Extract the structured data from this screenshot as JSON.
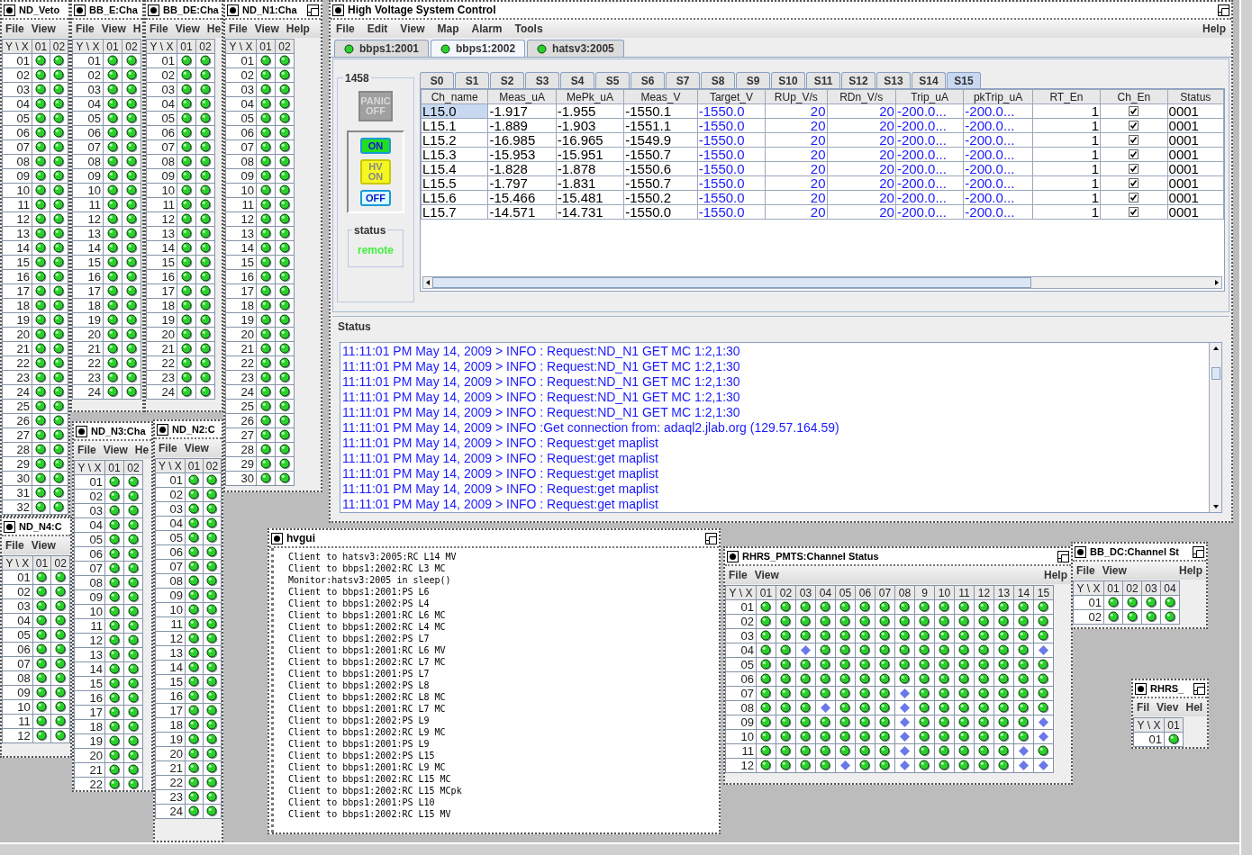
{
  "channel_windows": [
    {
      "title": "ND_Veto",
      "menu": [
        "File",
        "View"
      ],
      "columns": [
        "Y \\ X",
        "01",
        "02"
      ],
      "rows": [
        {
          "label": "01",
          "cells": [
            true,
            true
          ]
        },
        {
          "label": "02",
          "cells": [
            true,
            true
          ]
        },
        {
          "label": "03",
          "cells": [
            true,
            true
          ]
        },
        {
          "label": "04",
          "cells": [
            true,
            true
          ]
        },
        {
          "label": "05",
          "cells": [
            true,
            true
          ]
        },
        {
          "label": "06",
          "cells": [
            true,
            true
          ]
        },
        {
          "label": "07",
          "cells": [
            true,
            true
          ]
        },
        {
          "label": "08",
          "cells": [
            true,
            true
          ]
        },
        {
          "label": "09",
          "cells": [
            true,
            true
          ]
        },
        {
          "label": "10",
          "cells": [
            true,
            true
          ]
        },
        {
          "label": "11",
          "cells": [
            true,
            true
          ]
        },
        {
          "label": "12",
          "cells": [
            true,
            true
          ]
        },
        {
          "label": "13",
          "cells": [
            true,
            true
          ]
        },
        {
          "label": "14",
          "cells": [
            true,
            true
          ]
        },
        {
          "label": "15",
          "cells": [
            true,
            true
          ]
        },
        {
          "label": "16",
          "cells": [
            true,
            true
          ]
        },
        {
          "label": "17",
          "cells": [
            true,
            true
          ]
        },
        {
          "label": "18",
          "cells": [
            true,
            true
          ]
        },
        {
          "label": "19",
          "cells": [
            true,
            true
          ]
        },
        {
          "label": "20",
          "cells": [
            true,
            true
          ]
        },
        {
          "label": "21",
          "cells": [
            true,
            true
          ]
        },
        {
          "label": "22",
          "cells": [
            true,
            true
          ]
        },
        {
          "label": "23",
          "cells": [
            true,
            true
          ]
        },
        {
          "label": "24",
          "cells": [
            true,
            true
          ]
        },
        {
          "label": "25",
          "cells": [
            true,
            true
          ]
        },
        {
          "label": "26",
          "cells": [
            true,
            true
          ]
        },
        {
          "label": "27",
          "cells": [
            true,
            true
          ]
        },
        {
          "label": "28",
          "cells": [
            true,
            true
          ]
        },
        {
          "label": "29",
          "cells": [
            true,
            true
          ]
        },
        {
          "label": "30",
          "cells": [
            true,
            true
          ]
        },
        {
          "label": "31",
          "cells": [
            true,
            true
          ]
        },
        {
          "label": "32",
          "cells": [
            true,
            true
          ]
        }
      ]
    },
    {
      "title": "BB_E:Cha",
      "menu": [
        "File",
        "View",
        "H"
      ],
      "columns": [
        "Y \\ X",
        "01",
        "02"
      ],
      "rows": [
        {
          "label": "01",
          "cells": [
            true,
            true
          ]
        },
        {
          "label": "02",
          "cells": [
            true,
            true
          ]
        },
        {
          "label": "03",
          "cells": [
            true,
            true
          ]
        },
        {
          "label": "04",
          "cells": [
            true,
            true
          ]
        },
        {
          "label": "05",
          "cells": [
            true,
            true
          ]
        },
        {
          "label": "06",
          "cells": [
            true,
            true
          ]
        },
        {
          "label": "07",
          "cells": [
            true,
            true
          ]
        },
        {
          "label": "08",
          "cells": [
            true,
            true
          ]
        },
        {
          "label": "09",
          "cells": [
            true,
            true
          ]
        },
        {
          "label": "10",
          "cells": [
            true,
            true
          ]
        },
        {
          "label": "11",
          "cells": [
            true,
            true
          ]
        },
        {
          "label": "12",
          "cells": [
            true,
            true
          ]
        },
        {
          "label": "13",
          "cells": [
            true,
            true
          ]
        },
        {
          "label": "14",
          "cells": [
            true,
            true
          ]
        },
        {
          "label": "15",
          "cells": [
            true,
            true
          ]
        },
        {
          "label": "16",
          "cells": [
            true,
            true
          ]
        },
        {
          "label": "17",
          "cells": [
            true,
            true
          ]
        },
        {
          "label": "18",
          "cells": [
            true,
            true
          ]
        },
        {
          "label": "19",
          "cells": [
            true,
            true
          ]
        },
        {
          "label": "20",
          "cells": [
            true,
            true
          ]
        },
        {
          "label": "21",
          "cells": [
            true,
            true
          ]
        },
        {
          "label": "22",
          "cells": [
            true,
            true
          ]
        },
        {
          "label": "23",
          "cells": [
            true,
            true
          ]
        },
        {
          "label": "24",
          "cells": [
            true,
            true
          ]
        }
      ]
    },
    {
      "title": "BB_DE:Cha",
      "menu": [
        "File",
        "View",
        "He"
      ],
      "columns": [
        "Y \\ X",
        "01",
        "02"
      ],
      "rows": [
        {
          "label": "01",
          "cells": [
            true,
            true
          ]
        },
        {
          "label": "02",
          "cells": [
            true,
            true
          ]
        },
        {
          "label": "03",
          "cells": [
            true,
            true
          ]
        },
        {
          "label": "04",
          "cells": [
            true,
            true
          ]
        },
        {
          "label": "05",
          "cells": [
            true,
            true
          ]
        },
        {
          "label": "06",
          "cells": [
            true,
            true
          ]
        },
        {
          "label": "07",
          "cells": [
            true,
            true
          ]
        },
        {
          "label": "08",
          "cells": [
            true,
            true
          ]
        },
        {
          "label": "09",
          "cells": [
            true,
            true
          ]
        },
        {
          "label": "10",
          "cells": [
            true,
            true
          ]
        },
        {
          "label": "11",
          "cells": [
            true,
            true
          ]
        },
        {
          "label": "12",
          "cells": [
            true,
            true
          ]
        },
        {
          "label": "13",
          "cells": [
            true,
            true
          ]
        },
        {
          "label": "14",
          "cells": [
            true,
            true
          ]
        },
        {
          "label": "15",
          "cells": [
            true,
            true
          ]
        },
        {
          "label": "16",
          "cells": [
            true,
            true
          ]
        },
        {
          "label": "17",
          "cells": [
            true,
            true
          ]
        },
        {
          "label": "18",
          "cells": [
            true,
            true
          ]
        },
        {
          "label": "19",
          "cells": [
            true,
            true
          ]
        },
        {
          "label": "20",
          "cells": [
            true,
            true
          ]
        },
        {
          "label": "21",
          "cells": [
            true,
            true
          ]
        },
        {
          "label": "22",
          "cells": [
            true,
            true
          ]
        },
        {
          "label": "23",
          "cells": [
            true,
            true
          ]
        },
        {
          "label": "24",
          "cells": [
            true,
            true
          ]
        }
      ]
    },
    {
      "title": "ND_N1:Cha",
      "menu": [
        "File",
        "View",
        "Help"
      ],
      "columns": [
        "Y \\ X",
        "01",
        "02"
      ],
      "rows": [
        {
          "label": "01",
          "cells": [
            true,
            true
          ]
        },
        {
          "label": "02",
          "cells": [
            true,
            true
          ]
        },
        {
          "label": "03",
          "cells": [
            true,
            true
          ]
        },
        {
          "label": "04",
          "cells": [
            true,
            true
          ]
        },
        {
          "label": "05",
          "cells": [
            true,
            true
          ]
        },
        {
          "label": "06",
          "cells": [
            true,
            true
          ]
        },
        {
          "label": "07",
          "cells": [
            true,
            true
          ]
        },
        {
          "label": "08",
          "cells": [
            true,
            true
          ]
        },
        {
          "label": "09",
          "cells": [
            true,
            true
          ]
        },
        {
          "label": "10",
          "cells": [
            true,
            true
          ]
        },
        {
          "label": "11",
          "cells": [
            true,
            true
          ]
        },
        {
          "label": "12",
          "cells": [
            true,
            true
          ]
        },
        {
          "label": "13",
          "cells": [
            true,
            true
          ]
        },
        {
          "label": "14",
          "cells": [
            true,
            true
          ]
        },
        {
          "label": "15",
          "cells": [
            true,
            true
          ]
        },
        {
          "label": "16",
          "cells": [
            true,
            true
          ]
        },
        {
          "label": "17",
          "cells": [
            true,
            true
          ]
        },
        {
          "label": "18",
          "cells": [
            true,
            true
          ]
        },
        {
          "label": "19",
          "cells": [
            true,
            true
          ]
        },
        {
          "label": "20",
          "cells": [
            true,
            true
          ]
        },
        {
          "label": "21",
          "cells": [
            true,
            true
          ]
        },
        {
          "label": "22",
          "cells": [
            true,
            true
          ]
        },
        {
          "label": "23",
          "cells": [
            true,
            true
          ]
        },
        {
          "label": "24",
          "cells": [
            true,
            true
          ]
        },
        {
          "label": "25",
          "cells": [
            true,
            true
          ]
        },
        {
          "label": "26",
          "cells": [
            true,
            true
          ]
        },
        {
          "label": "27",
          "cells": [
            true,
            true
          ]
        },
        {
          "label": "28",
          "cells": [
            true,
            true
          ]
        },
        {
          "label": "29",
          "cells": [
            true,
            true
          ]
        },
        {
          "label": "30",
          "cells": [
            true,
            true
          ]
        }
      ]
    },
    {
      "title": "ND_N3:Cha",
      "menu": [
        "File",
        "View",
        "He"
      ],
      "columns": [
        "Y \\ X",
        "01",
        "02"
      ],
      "rows": [
        {
          "label": "01",
          "cells": [
            true,
            true
          ]
        },
        {
          "label": "02",
          "cells": [
            true,
            true
          ]
        },
        {
          "label": "03",
          "cells": [
            true,
            true
          ]
        },
        {
          "label": "04",
          "cells": [
            true,
            true
          ]
        },
        {
          "label": "05",
          "cells": [
            true,
            true
          ]
        },
        {
          "label": "06",
          "cells": [
            true,
            true
          ]
        },
        {
          "label": "07",
          "cells": [
            true,
            true
          ]
        },
        {
          "label": "08",
          "cells": [
            true,
            true
          ]
        },
        {
          "label": "09",
          "cells": [
            true,
            true
          ]
        },
        {
          "label": "10",
          "cells": [
            true,
            true
          ]
        },
        {
          "label": "11",
          "cells": [
            true,
            true
          ]
        },
        {
          "label": "12",
          "cells": [
            true,
            true
          ]
        },
        {
          "label": "13",
          "cells": [
            true,
            true
          ]
        },
        {
          "label": "14",
          "cells": [
            true,
            true
          ]
        },
        {
          "label": "15",
          "cells": [
            true,
            true
          ]
        },
        {
          "label": "16",
          "cells": [
            true,
            true
          ]
        },
        {
          "label": "17",
          "cells": [
            true,
            true
          ]
        },
        {
          "label": "18",
          "cells": [
            true,
            true
          ]
        },
        {
          "label": "19",
          "cells": [
            true,
            true
          ]
        },
        {
          "label": "20",
          "cells": [
            true,
            true
          ]
        },
        {
          "label": "21",
          "cells": [
            true,
            true
          ]
        },
        {
          "label": "22",
          "cells": [
            true,
            true
          ]
        }
      ]
    },
    {
      "title": "ND_N2:C",
      "menu": [
        "File",
        "View"
      ],
      "columns": [
        "Y \\ X",
        "01",
        "02"
      ],
      "rows": [
        {
          "label": "01",
          "cells": [
            true,
            true
          ]
        },
        {
          "label": "02",
          "cells": [
            true,
            true
          ]
        },
        {
          "label": "03",
          "cells": [
            true,
            true
          ]
        },
        {
          "label": "04",
          "cells": [
            true,
            true
          ]
        },
        {
          "label": "05",
          "cells": [
            true,
            true
          ]
        },
        {
          "label": "06",
          "cells": [
            true,
            true
          ]
        },
        {
          "label": "07",
          "cells": [
            true,
            true
          ]
        },
        {
          "label": "08",
          "cells": [
            true,
            true
          ]
        },
        {
          "label": "09",
          "cells": [
            true,
            true
          ]
        },
        {
          "label": "10",
          "cells": [
            true,
            true
          ]
        },
        {
          "label": "11",
          "cells": [
            true,
            true
          ]
        },
        {
          "label": "12",
          "cells": [
            true,
            true
          ]
        },
        {
          "label": "13",
          "cells": [
            true,
            true
          ]
        },
        {
          "label": "14",
          "cells": [
            true,
            true
          ]
        },
        {
          "label": "15",
          "cells": [
            true,
            true
          ]
        },
        {
          "label": "16",
          "cells": [
            true,
            true
          ]
        },
        {
          "label": "17",
          "cells": [
            true,
            true
          ]
        },
        {
          "label": "18",
          "cells": [
            true,
            true
          ]
        },
        {
          "label": "19",
          "cells": [
            true,
            true
          ]
        },
        {
          "label": "20",
          "cells": [
            true,
            true
          ]
        },
        {
          "label": "21",
          "cells": [
            true,
            true
          ]
        },
        {
          "label": "22",
          "cells": [
            true,
            true
          ]
        },
        {
          "label": "23",
          "cells": [
            true,
            true
          ]
        },
        {
          "label": "24",
          "cells": [
            true,
            true
          ]
        }
      ]
    },
    {
      "title": "ND_N4:C",
      "menu": [
        "File",
        "View"
      ],
      "columns": [
        "Y \\ X",
        "01",
        "02"
      ],
      "rows": [
        {
          "label": "01",
          "cells": [
            true,
            true
          ]
        },
        {
          "label": "02",
          "cells": [
            true,
            true
          ]
        },
        {
          "label": "03",
          "cells": [
            true,
            true
          ]
        },
        {
          "label": "04",
          "cells": [
            true,
            true
          ]
        },
        {
          "label": "05",
          "cells": [
            true,
            true
          ]
        },
        {
          "label": "06",
          "cells": [
            true,
            true
          ]
        },
        {
          "label": "07",
          "cells": [
            true,
            true
          ]
        },
        {
          "label": "08",
          "cells": [
            true,
            true
          ]
        },
        {
          "label": "09",
          "cells": [
            true,
            true
          ]
        },
        {
          "label": "10",
          "cells": [
            true,
            true
          ]
        },
        {
          "label": "11",
          "cells": [
            true,
            true
          ]
        },
        {
          "label": "12",
          "cells": [
            true,
            true
          ]
        }
      ]
    },
    {
      "title": "RHRS_PMTS:Channel Status",
      "menu": [
        "File",
        "View"
      ],
      "menu_right": "Help",
      "columns": [
        "Y \\ X",
        "01",
        "02",
        "03",
        "04",
        "05",
        "06",
        "07",
        "08",
        "9",
        "10",
        "11",
        "12",
        "13",
        "14",
        "15"
      ],
      "rows": [
        {
          "label": "01",
          "cells": [
            true,
            true,
            true,
            true,
            true,
            true,
            true,
            true,
            true,
            true,
            true,
            true,
            true,
            true,
            true
          ]
        },
        {
          "label": "02",
          "cells": [
            true,
            true,
            true,
            true,
            true,
            true,
            true,
            true,
            true,
            true,
            true,
            true,
            true,
            true,
            true
          ]
        },
        {
          "label": "03",
          "cells": [
            true,
            true,
            true,
            true,
            true,
            true,
            true,
            true,
            true,
            true,
            true,
            true,
            true,
            true,
            true
          ]
        },
        {
          "label": "04",
          "cells": [
            true,
            true,
            false,
            true,
            true,
            true,
            true,
            true,
            true,
            true,
            true,
            true,
            true,
            true,
            false
          ]
        },
        {
          "label": "05",
          "cells": [
            true,
            true,
            true,
            true,
            true,
            true,
            true,
            true,
            true,
            true,
            true,
            true,
            true,
            true,
            true
          ]
        },
        {
          "label": "06",
          "cells": [
            true,
            true,
            true,
            true,
            true,
            true,
            true,
            true,
            true,
            true,
            true,
            true,
            true,
            true,
            true
          ]
        },
        {
          "label": "07",
          "cells": [
            true,
            true,
            true,
            true,
            true,
            true,
            true,
            false,
            true,
            true,
            true,
            true,
            true,
            true,
            true
          ]
        },
        {
          "label": "08",
          "cells": [
            true,
            true,
            true,
            false,
            true,
            true,
            true,
            false,
            true,
            true,
            true,
            true,
            true,
            true,
            true
          ]
        },
        {
          "label": "09",
          "cells": [
            true,
            true,
            true,
            true,
            true,
            true,
            true,
            false,
            true,
            true,
            true,
            true,
            true,
            true,
            false
          ]
        },
        {
          "label": "10",
          "cells": [
            true,
            true,
            true,
            true,
            true,
            true,
            true,
            false,
            true,
            true,
            true,
            true,
            true,
            true,
            false
          ]
        },
        {
          "label": "11",
          "cells": [
            true,
            true,
            true,
            true,
            true,
            true,
            true,
            false,
            true,
            true,
            true,
            true,
            true,
            false,
            true
          ]
        },
        {
          "label": "12",
          "cells": [
            true,
            true,
            true,
            true,
            false,
            true,
            true,
            false,
            true,
            true,
            true,
            true,
            true,
            false,
            false
          ]
        }
      ]
    },
    {
      "title": "BB_DC:Channel St",
      "menu": [
        "File",
        "View"
      ],
      "menu_right": "Help",
      "columns": [
        "Y \\ X",
        "01",
        "02",
        "03",
        "04"
      ],
      "rows": [
        {
          "label": "01",
          "cells": [
            true,
            true,
            true,
            true
          ]
        },
        {
          "label": "02",
          "cells": [
            true,
            true,
            true,
            true
          ]
        }
      ]
    },
    {
      "title": "RHRS_",
      "menu": [
        "Fil",
        "Viev",
        "Hel"
      ],
      "columns": [
        "Y \\ X",
        "01"
      ],
      "rows": [
        {
          "label": "01",
          "cells": [
            true
          ]
        }
      ]
    }
  ],
  "main_window": {
    "title": "High Voltage System Control",
    "menu": [
      "File",
      "Edit",
      "View",
      "Map",
      "Alarm",
      "Tools"
    ],
    "menu_right": "Help",
    "servers": [
      {
        "label": "bbps1:2001",
        "selected": false
      },
      {
        "label": "bbps1:2002",
        "selected": true
      },
      {
        "label": "hatsv3:2005",
        "selected": false
      }
    ],
    "control": {
      "title": "1458",
      "panic": {
        "lines": [
          "PANIC",
          "OFF"
        ],
        "disabled": true
      },
      "buttons": [
        {
          "kind": "on",
          "lines": [
            "ON"
          ]
        },
        {
          "kind": "hv_on",
          "lines": [
            "HV",
            "ON"
          ]
        },
        {
          "kind": "off",
          "lines": [
            "OFF"
          ]
        }
      ],
      "status_title": "status",
      "status": "remote"
    },
    "slots": [
      {
        "label": "S0",
        "selected": false
      },
      {
        "label": "S1",
        "selected": false
      },
      {
        "label": "S2",
        "selected": false
      },
      {
        "label": "S3",
        "selected": false
      },
      {
        "label": "S4",
        "selected": false
      },
      {
        "label": "S5",
        "selected": false
      },
      {
        "label": "S6",
        "selected": false
      },
      {
        "label": "S7",
        "selected": false
      },
      {
        "label": "S8",
        "selected": false
      },
      {
        "label": "S9",
        "selected": false
      },
      {
        "label": "S10",
        "selected": false
      },
      {
        "label": "S11",
        "selected": false
      },
      {
        "label": "S12",
        "selected": false
      },
      {
        "label": "S13",
        "selected": false
      },
      {
        "label": "S14",
        "selected": false
      },
      {
        "label": "S15",
        "selected": true
      }
    ],
    "table": {
      "columns": [
        "Ch_name",
        "Meas_uA",
        "MePk_uA",
        "Meas_V",
        "Target_V",
        "RUp_V/s",
        "RDn_V/s",
        "Trip_uA",
        "pkTrip_uA",
        "RT_En",
        "Ch_En",
        "Status"
      ],
      "rows": [
        {
          "selected": true,
          "values": [
            "L15.0",
            "-1.917",
            "-1.955",
            "-1550.1",
            "-1550.0",
            "20",
            "20",
            "-200.0...",
            "-200.0...",
            "1"
          ],
          "enabled": true,
          "status": "0001"
        },
        {
          "selected": false,
          "values": [
            "L15.1",
            "-1.889",
            "-1.903",
            "-1551.1",
            "-1550.0",
            "20",
            "20",
            "-200.0...",
            "-200.0...",
            "1"
          ],
          "enabled": true,
          "status": "0001"
        },
        {
          "selected": false,
          "values": [
            "L15.2",
            "-16.985",
            "-16.965",
            "-1549.9",
            "-1550.0",
            "20",
            "20",
            "-200.0...",
            "-200.0...",
            "1"
          ],
          "enabled": true,
          "status": "0001"
        },
        {
          "selected": false,
          "values": [
            "L15.3",
            "-15.953",
            "-15.951",
            "-1550.7",
            "-1550.0",
            "20",
            "20",
            "-200.0...",
            "-200.0...",
            "1"
          ],
          "enabled": true,
          "status": "0001"
        },
        {
          "selected": false,
          "values": [
            "L15.4",
            "-1.828",
            "-1.878",
            "-1550.6",
            "-1550.0",
            "20",
            "20",
            "-200.0...",
            "-200.0...",
            "1"
          ],
          "enabled": true,
          "status": "0001"
        },
        {
          "selected": false,
          "values": [
            "L15.5",
            "-1.797",
            "-1.831",
            "-1550.7",
            "-1550.0",
            "20",
            "20",
            "-200.0...",
            "-200.0...",
            "1"
          ],
          "enabled": true,
          "status": "0001"
        },
        {
          "selected": false,
          "values": [
            "L15.6",
            "-15.466",
            "-15.481",
            "-1550.2",
            "-1550.0",
            "20",
            "20",
            "-200.0...",
            "-200.0...",
            "1"
          ],
          "enabled": true,
          "status": "0001"
        },
        {
          "selected": false,
          "values": [
            "L15.7",
            "-14.571",
            "-14.731",
            "-1550.0",
            "-1550.0",
            "20",
            "20",
            "-200.0...",
            "-200.0...",
            "1"
          ],
          "enabled": true,
          "status": "0001"
        }
      ]
    },
    "log_title": "Status",
    "log": [
      "11:11:01 PM May 14, 2009 > INFO : Request:ND_N1 GET MC 1:2,1:30",
      "11:11:01 PM May 14, 2009 > INFO : Request:ND_N1 GET MC 1:2,1:30",
      "11:11:01 PM May 14, 2009 > INFO : Request:ND_N1 GET MC 1:2,1:30",
      "11:11:01 PM May 14, 2009 > INFO : Request:ND_N1 GET MC 1:2,1:30",
      "11:11:01 PM May 14, 2009 > INFO : Request:ND_N1 GET MC 1:2,1:30",
      "11:11:01 PM May 14, 2009 > INFO :Get connection from: adaql2.jlab.org (129.57.164.59)",
      "11:11:01 PM May 14, 2009 > INFO : Request:get maplist",
      "11:11:01 PM May 14, 2009 > INFO : Request:get maplist",
      "11:11:01 PM May 14, 2009 > INFO : Request:get maplist",
      "11:11:01 PM May 14, 2009 > INFO : Request:get maplist",
      "11:11:01 PM May 14, 2009 > INFO : Request:get maplist"
    ]
  },
  "console": {
    "title": "hvgui",
    "lines": [
      "Client to hatsv3:2005:RC L14 MV",
      "Client to bbps1:2002:RC L3 MC",
      "Monitor:hatsv3:2005 in sleep()",
      "Client to bbps1:2001:PS L6",
      "Client to bbps1:2002:PS L4",
      "Client to bbps1:2001:RC L6 MC",
      "Client to bbps1:2002:RC L4 MC",
      "Client to bbps1:2002:PS L7",
      "Client to bbps1:2001:RC L6 MV",
      "Client to bbps1:2002:RC L7 MC",
      "Client to bbps1:2001:PS L7",
      "Client to bbps1:2002:PS L8",
      "Client to bbps1:2002:RC L8 MC",
      "Client to bbps1:2001:RC L7 MC",
      "Client to bbps1:2002:PS L9",
      "Client to bbps1:2002:RC L9 MC",
      "Client to bbps1:2001:PS L9",
      "Client to bbps1:2002:PS L15",
      "Client to bbps1:2001:RC L9 MC",
      "Client to bbps1:2002:RC L15 MC",
      "Client to bbps1:2002:RC L15 MCpk",
      "Client to bbps1:2001:PS L10",
      "Client to bbps1:2002:RC L15 MV"
    ]
  }
}
